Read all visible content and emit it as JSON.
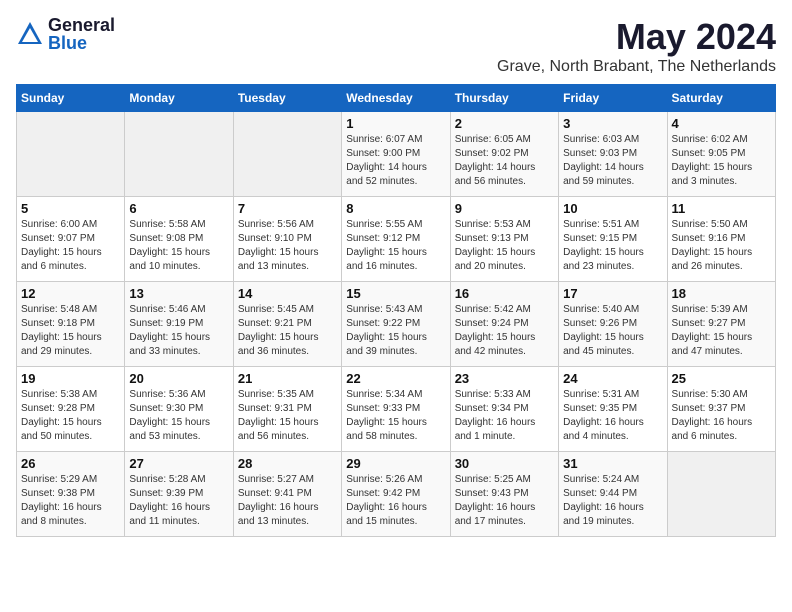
{
  "logo": {
    "general": "General",
    "blue": "Blue"
  },
  "title": "May 2024",
  "subtitle": "Grave, North Brabant, The Netherlands",
  "days_of_week": [
    "Sunday",
    "Monday",
    "Tuesday",
    "Wednesday",
    "Thursday",
    "Friday",
    "Saturday"
  ],
  "weeks": [
    [
      {
        "day": "",
        "info": ""
      },
      {
        "day": "",
        "info": ""
      },
      {
        "day": "",
        "info": ""
      },
      {
        "day": "1",
        "info": "Sunrise: 6:07 AM\nSunset: 9:00 PM\nDaylight: 14 hours and 52 minutes."
      },
      {
        "day": "2",
        "info": "Sunrise: 6:05 AM\nSunset: 9:02 PM\nDaylight: 14 hours and 56 minutes."
      },
      {
        "day": "3",
        "info": "Sunrise: 6:03 AM\nSunset: 9:03 PM\nDaylight: 14 hours and 59 minutes."
      },
      {
        "day": "4",
        "info": "Sunrise: 6:02 AM\nSunset: 9:05 PM\nDaylight: 15 hours and 3 minutes."
      }
    ],
    [
      {
        "day": "5",
        "info": "Sunrise: 6:00 AM\nSunset: 9:07 PM\nDaylight: 15 hours and 6 minutes."
      },
      {
        "day": "6",
        "info": "Sunrise: 5:58 AM\nSunset: 9:08 PM\nDaylight: 15 hours and 10 minutes."
      },
      {
        "day": "7",
        "info": "Sunrise: 5:56 AM\nSunset: 9:10 PM\nDaylight: 15 hours and 13 minutes."
      },
      {
        "day": "8",
        "info": "Sunrise: 5:55 AM\nSunset: 9:12 PM\nDaylight: 15 hours and 16 minutes."
      },
      {
        "day": "9",
        "info": "Sunrise: 5:53 AM\nSunset: 9:13 PM\nDaylight: 15 hours and 20 minutes."
      },
      {
        "day": "10",
        "info": "Sunrise: 5:51 AM\nSunset: 9:15 PM\nDaylight: 15 hours and 23 minutes."
      },
      {
        "day": "11",
        "info": "Sunrise: 5:50 AM\nSunset: 9:16 PM\nDaylight: 15 hours and 26 minutes."
      }
    ],
    [
      {
        "day": "12",
        "info": "Sunrise: 5:48 AM\nSunset: 9:18 PM\nDaylight: 15 hours and 29 minutes."
      },
      {
        "day": "13",
        "info": "Sunrise: 5:46 AM\nSunset: 9:19 PM\nDaylight: 15 hours and 33 minutes."
      },
      {
        "day": "14",
        "info": "Sunrise: 5:45 AM\nSunset: 9:21 PM\nDaylight: 15 hours and 36 minutes."
      },
      {
        "day": "15",
        "info": "Sunrise: 5:43 AM\nSunset: 9:22 PM\nDaylight: 15 hours and 39 minutes."
      },
      {
        "day": "16",
        "info": "Sunrise: 5:42 AM\nSunset: 9:24 PM\nDaylight: 15 hours and 42 minutes."
      },
      {
        "day": "17",
        "info": "Sunrise: 5:40 AM\nSunset: 9:26 PM\nDaylight: 15 hours and 45 minutes."
      },
      {
        "day": "18",
        "info": "Sunrise: 5:39 AM\nSunset: 9:27 PM\nDaylight: 15 hours and 47 minutes."
      }
    ],
    [
      {
        "day": "19",
        "info": "Sunrise: 5:38 AM\nSunset: 9:28 PM\nDaylight: 15 hours and 50 minutes."
      },
      {
        "day": "20",
        "info": "Sunrise: 5:36 AM\nSunset: 9:30 PM\nDaylight: 15 hours and 53 minutes."
      },
      {
        "day": "21",
        "info": "Sunrise: 5:35 AM\nSunset: 9:31 PM\nDaylight: 15 hours and 56 minutes."
      },
      {
        "day": "22",
        "info": "Sunrise: 5:34 AM\nSunset: 9:33 PM\nDaylight: 15 hours and 58 minutes."
      },
      {
        "day": "23",
        "info": "Sunrise: 5:33 AM\nSunset: 9:34 PM\nDaylight: 16 hours and 1 minute."
      },
      {
        "day": "24",
        "info": "Sunrise: 5:31 AM\nSunset: 9:35 PM\nDaylight: 16 hours and 4 minutes."
      },
      {
        "day": "25",
        "info": "Sunrise: 5:30 AM\nSunset: 9:37 PM\nDaylight: 16 hours and 6 minutes."
      }
    ],
    [
      {
        "day": "26",
        "info": "Sunrise: 5:29 AM\nSunset: 9:38 PM\nDaylight: 16 hours and 8 minutes."
      },
      {
        "day": "27",
        "info": "Sunrise: 5:28 AM\nSunset: 9:39 PM\nDaylight: 16 hours and 11 minutes."
      },
      {
        "day": "28",
        "info": "Sunrise: 5:27 AM\nSunset: 9:41 PM\nDaylight: 16 hours and 13 minutes."
      },
      {
        "day": "29",
        "info": "Sunrise: 5:26 AM\nSunset: 9:42 PM\nDaylight: 16 hours and 15 minutes."
      },
      {
        "day": "30",
        "info": "Sunrise: 5:25 AM\nSunset: 9:43 PM\nDaylight: 16 hours and 17 minutes."
      },
      {
        "day": "31",
        "info": "Sunrise: 5:24 AM\nSunset: 9:44 PM\nDaylight: 16 hours and 19 minutes."
      },
      {
        "day": "",
        "info": ""
      }
    ]
  ]
}
